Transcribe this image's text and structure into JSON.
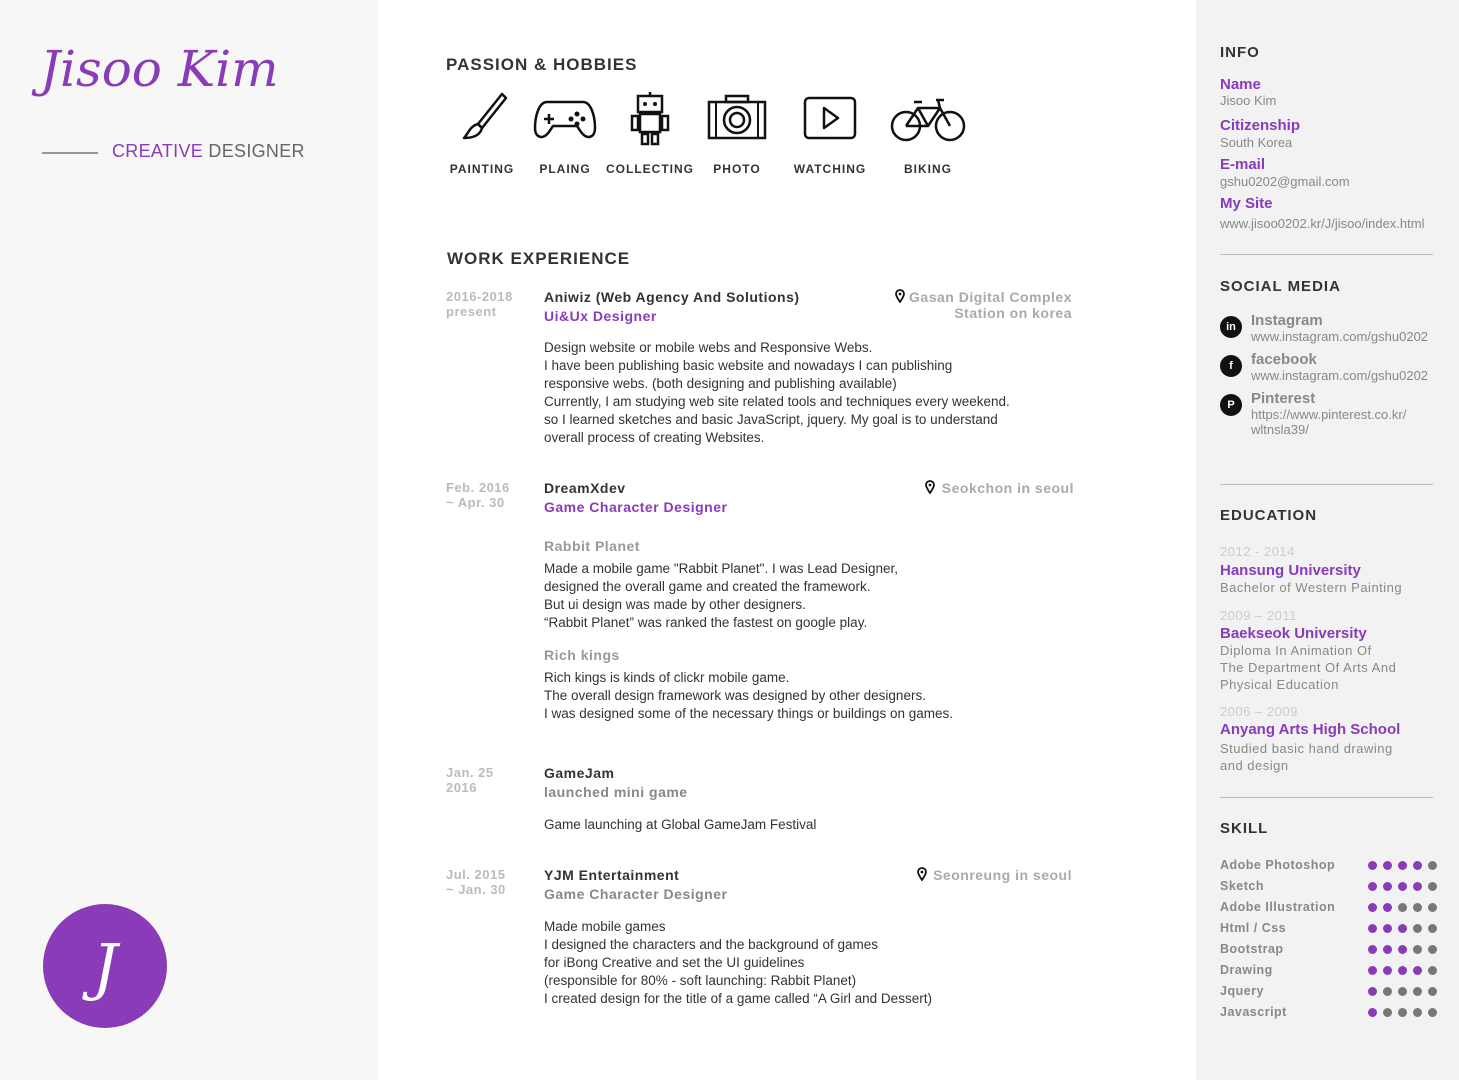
{
  "profile": {
    "name": "Jisoo Kim",
    "role_accent": "CREATIVE",
    "role_rest": "DESIGNER",
    "logo_letter": "J"
  },
  "hobbies": {
    "title": "PASSION & HOBBIES",
    "items": [
      {
        "label": "PAINTING",
        "icon": "paintbrush-icon"
      },
      {
        "label": "PLAING",
        "icon": "gamepad-icon"
      },
      {
        "label": "COLLECTING",
        "icon": "robot-icon"
      },
      {
        "label": "PHOTO",
        "icon": "camera-icon"
      },
      {
        "label": "WATCHING",
        "icon": "play-icon"
      },
      {
        "label": "BIKING",
        "icon": "bicycle-icon"
      }
    ]
  },
  "work": {
    "title": "WORK EXPERIENCE",
    "jobs": [
      {
        "date": "2016-2018\npresent",
        "company": "Aniwiz (Web Agency And Solutions)",
        "title": "Ui&Ux Designer",
        "location": "Gasan Digital Complex\nStation on korea",
        "desc": "Design website or mobile webs and Responsive Webs.\nI have been publishing basic website and nowadays I can publishing\nresponsive webs. (both designing and publishing available)\nCurrently, I am studying web site related tools and techniques every weekend.\nso I learned sketches and basic JavaScript, jquery. My goal is to understand\noverall process of creating Websites."
      },
      {
        "date": "Feb. 2016\n~ Apr. 30",
        "company": "DreamXdev",
        "title": "Game Character Designer",
        "location": "Seokchon in seoul",
        "projects": [
          {
            "name": "Rabbit Planet",
            "desc": "Made a mobile game \"Rabbit Planet\". I was Lead Designer,\ndesigned the overall game and created the framework.\nBut ui design was made by other designers.\n“Rabbit Planet” was ranked the fastest on google play."
          },
          {
            "name": "Rich kings",
            "desc": "Rich kings is kinds of clickr mobile game.\nThe overall design framework was designed by other designers.\nI was designed some of the necessary things or buildings on games."
          }
        ]
      },
      {
        "date": "Jan. 25\n2016",
        "company": "GameJam",
        "title": "launched mini game",
        "desc": "Game launching at Global GameJam Festival"
      },
      {
        "date": "Jul. 2015\n~ Jan. 30",
        "company": "YJM Entertainment",
        "title": "Game Character Designer",
        "location": "Seonreung in seoul",
        "desc": "Made mobile games\nI designed the characters and the background of games\nfor iBong Creative and set the UI guidelines\n(responsible for 80% - soft launching: Rabbit Planet)\nI created design for the title of a game called “A Girl and Dessert)"
      }
    ]
  },
  "info": {
    "title": "INFO",
    "name_label": "Name",
    "name_value": "Jisoo Kim",
    "citizenship_label": "Citizenship",
    "citizenship_value": "South Korea",
    "email_label": "E-mail",
    "email_value": "gshu0202@gmail.com",
    "site_label": "My Site",
    "site_value": "www.jisoo0202.kr/J/jisoo/index.html"
  },
  "social": {
    "title": "SOCIAL MEDIA",
    "items": [
      {
        "icon": "in",
        "name": "Instagram",
        "url": "www.instagram.com/gshu0202"
      },
      {
        "icon": "f",
        "name": "facebook",
        "url": "www.instagram.com/gshu0202"
      },
      {
        "icon": "P",
        "name": "Pinterest",
        "url": "https://www.pinterest.co.kr/\nwltnsla39/"
      }
    ]
  },
  "education": {
    "title": "EDUCATION",
    "items": [
      {
        "years": "2012 - 2014",
        "school": "Hansung University",
        "desc": "Bachelor of Western Painting"
      },
      {
        "years": "2009 – 2011",
        "school": "Baekseok University",
        "desc": "Diploma In Animation Of\nThe Department Of Arts And\nPhysical Education"
      },
      {
        "years": "2006 – 2009",
        "school": "Anyang Arts High School",
        "desc": "Studied basic hand drawing\nand design"
      }
    ]
  },
  "skills": {
    "title": "SKILL",
    "items": [
      {
        "name": "Adobe Photoshop",
        "level": 4
      },
      {
        "name": "Sketch",
        "level": 4
      },
      {
        "name": "Adobe Illustration",
        "level": 2
      },
      {
        "name": "Html / Css",
        "level": 3
      },
      {
        "name": "Bootstrap",
        "level": 3
      },
      {
        "name": "Drawing",
        "level": 4
      },
      {
        "name": "Jquery",
        "level": 1
      },
      {
        "name": "Javascript",
        "level": 1
      }
    ]
  },
  "colors": {
    "accent": "#8a3bb8",
    "sidebar": "#f2f2f2",
    "left_bg": "#f7f7f5"
  }
}
